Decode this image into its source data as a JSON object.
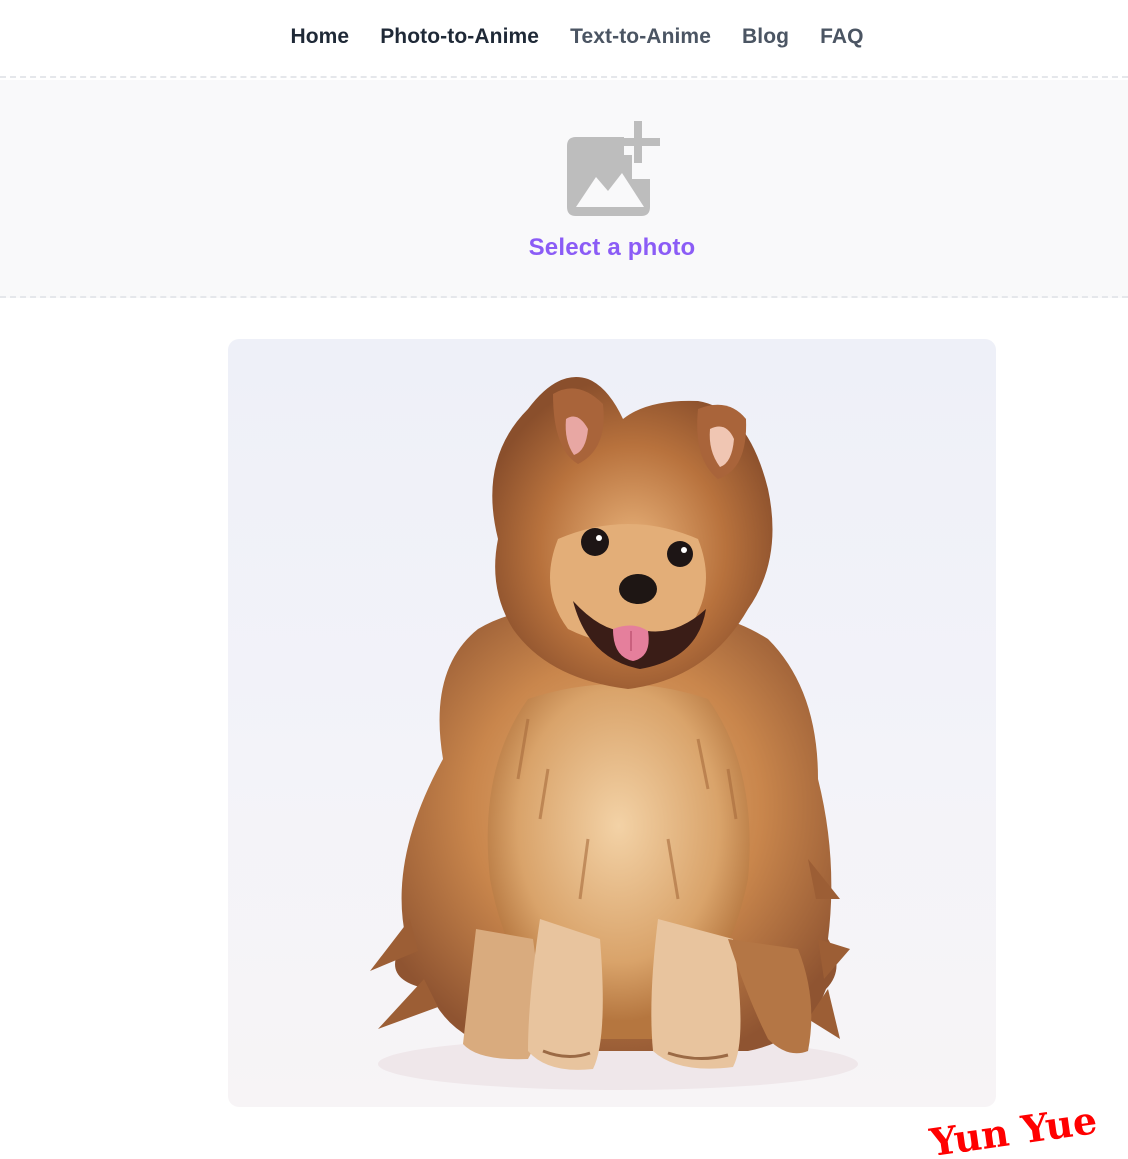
{
  "nav": {
    "items": [
      {
        "label": "Home"
      },
      {
        "label": "Photo-to-Anime"
      },
      {
        "label": "Text-to-Anime"
      },
      {
        "label": "Blog"
      },
      {
        "label": "FAQ"
      }
    ]
  },
  "upload": {
    "icon": "add-photo-icon",
    "label": "Select a photo",
    "label_color": "#8b5cf6",
    "icon_color": "#bdbdbd"
  },
  "result": {
    "image": "anime-style-pomeranian-dog"
  },
  "watermark": {
    "text": "Yun Yue",
    "color": "#ff0000"
  }
}
